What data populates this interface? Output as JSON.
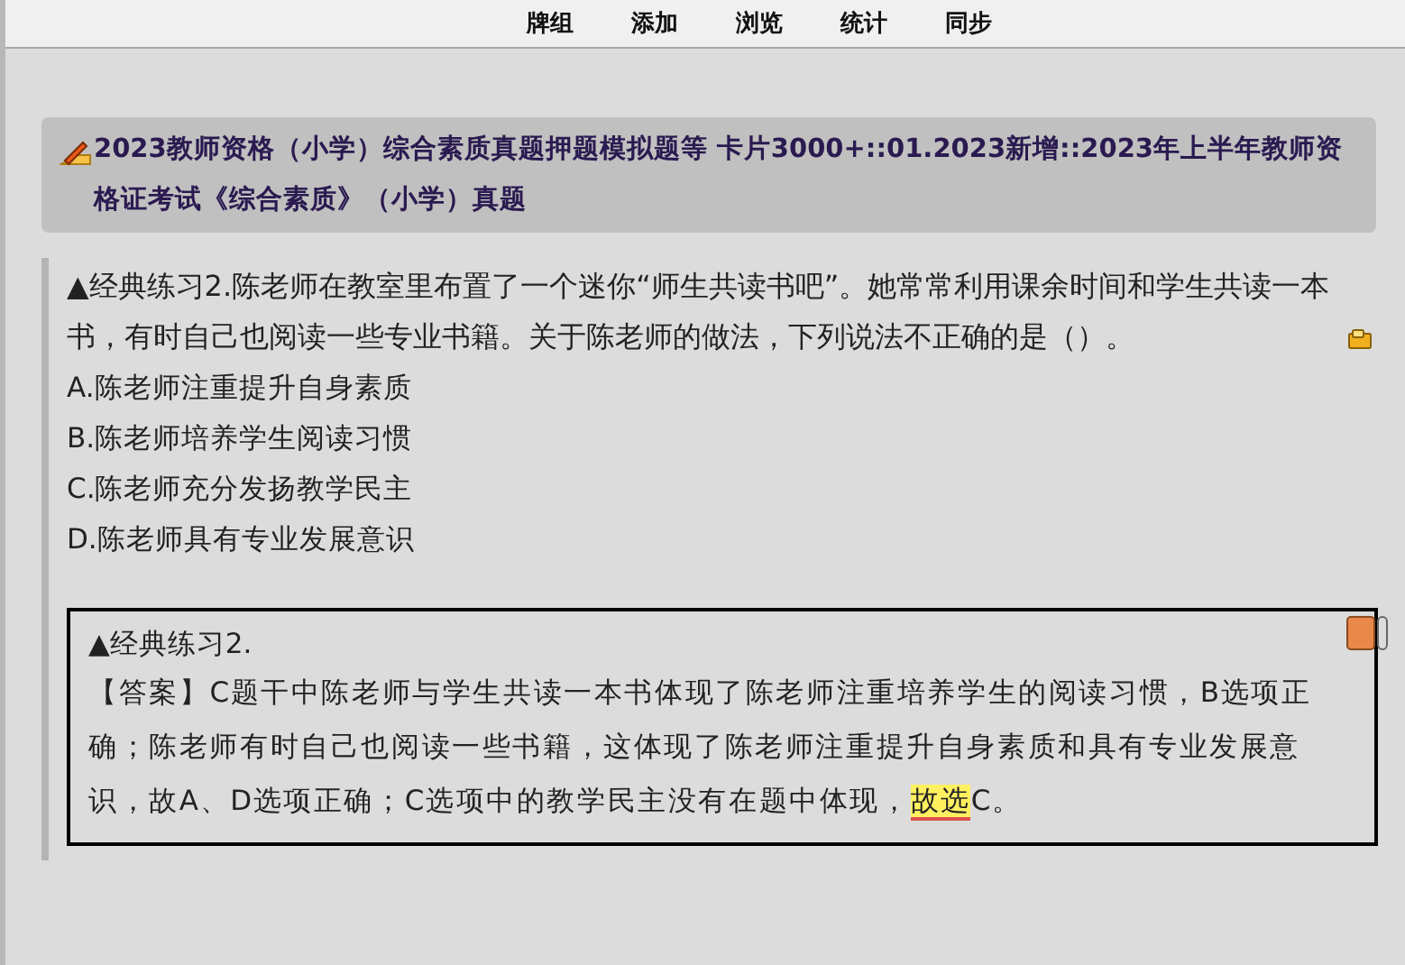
{
  "menu": [
    {
      "label": "牌组"
    },
    {
      "label": "添加"
    },
    {
      "label": "浏览"
    },
    {
      "label": "统计"
    },
    {
      "label": "同步"
    }
  ],
  "deck_title": "2023教师资格（小学）综合素质真题押题模拟题等 卡片3000+::01.2023新增::2023年上半年教师资格证考试《综合素质》（小学）真题",
  "question": {
    "stem": "▲经典练习2.陈老师在教室里布置了一个迷你“师生共读书吧”。她常常利用课余时间和学生共读一本书，有时自己也阅读一些专业书籍。关于陈老师的做法，下列说法不正确的是（）。",
    "options": [
      "A.陈老师注重提升自身素质",
      "B.陈老师培养学生阅读习惯",
      "C.陈老师充分发扬教学民主",
      "D.陈老师具有专业发展意识"
    ]
  },
  "answer": {
    "heading": "▲经典练习2.",
    "text_before": "【答案】C题干中陈老师与学生共读一本书体现了陈老师注重培养学生的阅读习惯，B选项正确；陈老师有时自己也阅读一些书籍，这体现了陈老师注重提升自身素质和具有专业发展意识，故A、D选项正确；C选项中的教学民主没有在题中体现，",
    "highlighted": "故选",
    "text_after": "C。"
  }
}
